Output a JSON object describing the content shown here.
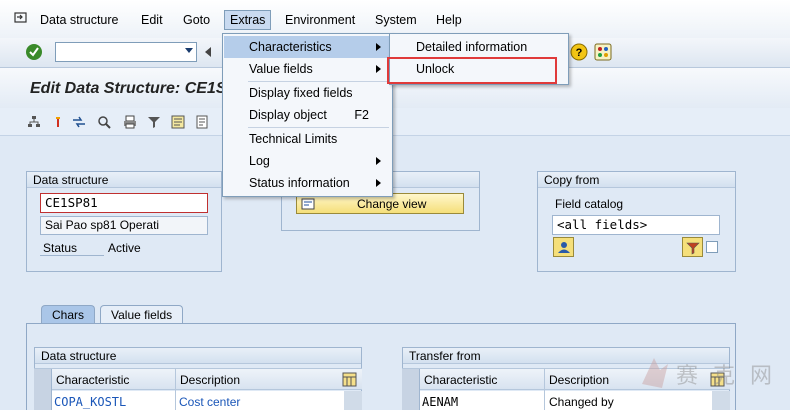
{
  "menubar": {
    "items": [
      "Data structure",
      "Edit",
      "Goto",
      "Extras",
      "Environment",
      "System",
      "Help"
    ]
  },
  "title": "Edit Data Structure: CE1SP81",
  "data_structure_group": {
    "header": "Data structure",
    "name": "CE1SP81",
    "description": "Sai Pao sp81 Operati",
    "status_label": "Status",
    "status_value": "Active"
  },
  "change_view_button": "Change view",
  "copy_from_group": {
    "header": "Copy from",
    "field_catalog_label": "Field catalog",
    "field_catalog_value": "<all fields>"
  },
  "tabs": [
    "Chars",
    "Value fields"
  ],
  "left_table": {
    "group_header": "Data structure",
    "columns": [
      "Characteristic",
      "Description"
    ],
    "rows": [
      {
        "characteristic": "COPA_KOSTL",
        "description": "Cost center"
      }
    ]
  },
  "right_table": {
    "group_header": "Transfer from",
    "columns": [
      "Characteristic",
      "Description"
    ],
    "rows": [
      {
        "characteristic": "AENAM",
        "description": "Changed by"
      }
    ]
  },
  "extras_menu": {
    "items": [
      {
        "label": "Characteristics",
        "submenu": true,
        "highlighted": true
      },
      {
        "label": "Value fields",
        "submenu": true
      },
      {
        "label": "Display fixed fields"
      },
      {
        "label": "Display object",
        "shortcut": "F2"
      },
      {
        "label": "Technical Limits"
      },
      {
        "label": "Log",
        "submenu": true
      },
      {
        "label": "Status information",
        "submenu": true
      }
    ]
  },
  "characteristics_submenu": {
    "items": [
      "Detailed information",
      "Unlock"
    ]
  },
  "colors": {
    "background": "#dfe9f5",
    "menu_highlight": "#b5cdea",
    "annotation_red": "#e03a3a",
    "link_blue": "#1a56b8"
  },
  "watermark": "赛 克 网"
}
